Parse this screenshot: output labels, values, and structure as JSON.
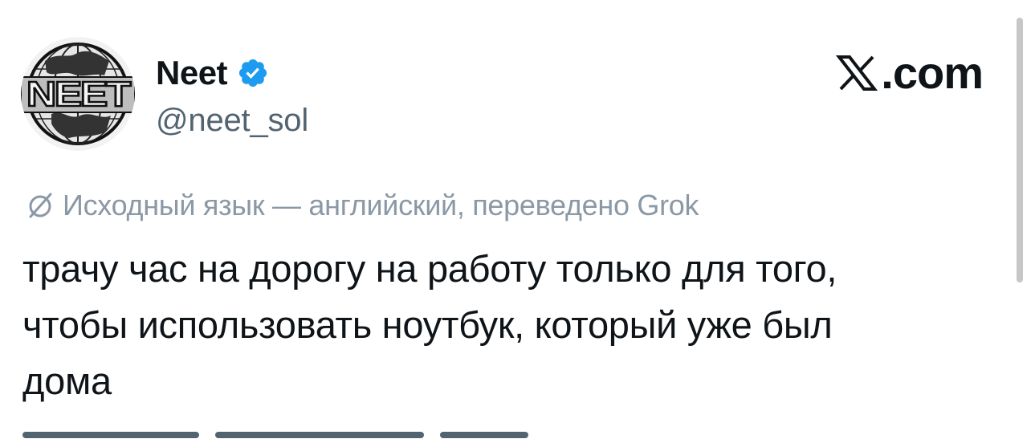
{
  "author": {
    "display_name": "Neet",
    "handle": "@neet_sol",
    "avatar_text": "NEET",
    "verified": true
  },
  "brand": {
    "logo_icon": "x-logo-icon",
    "text": ".com"
  },
  "translation_note": {
    "icon": "translate-icon",
    "text": "Исходный язык — английский, переведено Grok"
  },
  "post": {
    "lines": [
      "трачу час на дорогу на работу только для того,",
      "чтобы использовать ноутбук, который уже был",
      "дома"
    ]
  },
  "colors": {
    "text_primary": "#0f1419",
    "text_secondary": "#536471",
    "translate_gray": "#8b98a5",
    "verified_blue": "#1d9bf0"
  }
}
